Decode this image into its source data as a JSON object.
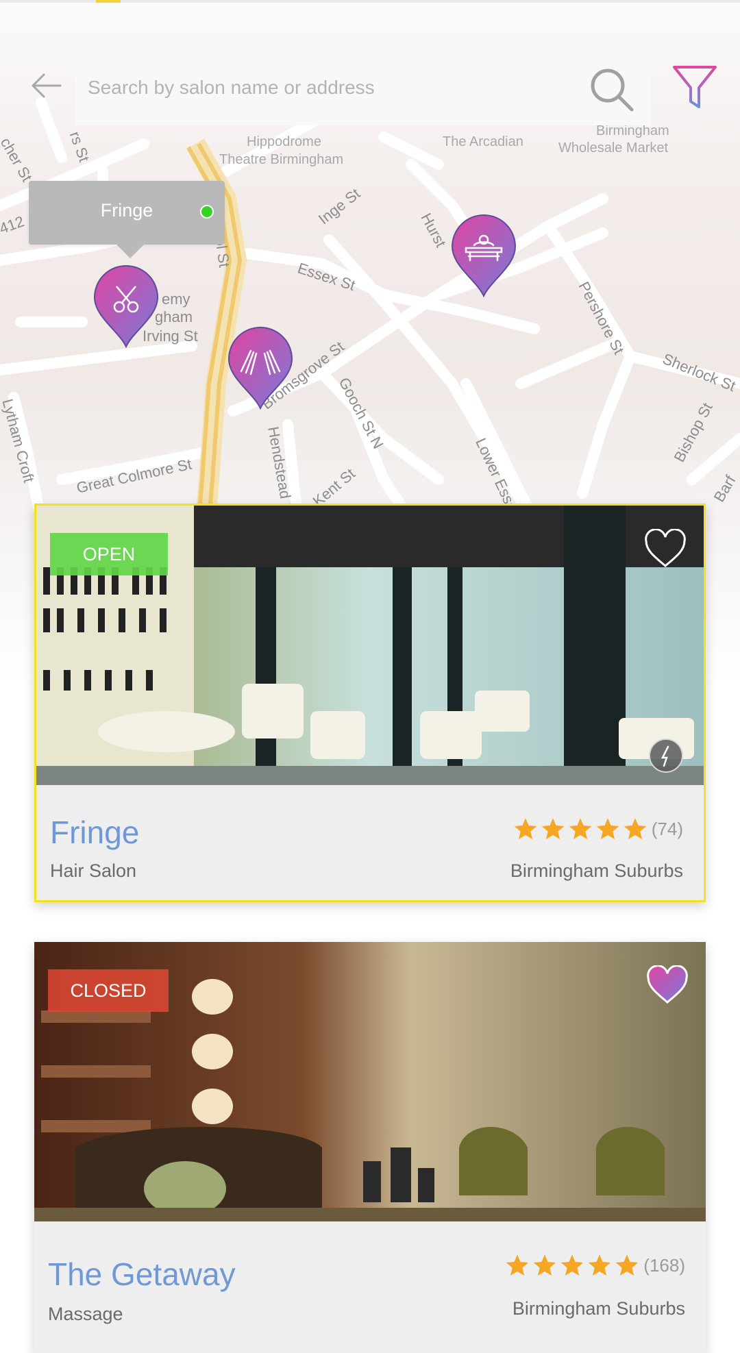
{
  "search": {
    "placeholder": "Search by salon name or address"
  },
  "map": {
    "street_labels": [
      "Hippodrome",
      "Theatre Birmingham",
      "The Arcadian",
      "Wholesale Market",
      "Birmingham",
      "Inge St",
      "Hurst",
      "Essex St",
      "Pershore St",
      "Sherlock St",
      "Bishop St",
      "Bristol St",
      "Irving St",
      "emy",
      "gham",
      "Bromsgrove St",
      "Gooch St N",
      "Hendstead St",
      "Lytham Croft",
      "Great Colmore St",
      "Kent St",
      "Lower Essex",
      "Barf",
      "cher St",
      "412",
      "rs St"
    ],
    "tooltip": {
      "name": "Fringe",
      "status_color": "#34d323"
    },
    "pins": [
      {
        "icon": "scissors-icon"
      },
      {
        "icon": "hands-icon"
      },
      {
        "icon": "massage-bed-icon"
      }
    ]
  },
  "colors": {
    "accent_blue": "#6e98d6",
    "pin_gradient_start": "#e045a0",
    "pin_gradient_end": "#7a7ad8",
    "star": "#f5a623",
    "open": "#61d649",
    "closed": "#de4834",
    "selected_border": "#f2e21c"
  },
  "salons": [
    {
      "status": "OPEN",
      "name": "Fringe",
      "type": "Hair Salon",
      "rating": 5,
      "review_count": "(74)",
      "area": "Birmingham Suburbs",
      "favorite": false,
      "selected": true
    },
    {
      "status": "CLOSED",
      "name": "The Getaway",
      "type": "Massage",
      "rating": 5,
      "review_count": "(168)",
      "area": "Birmingham Suburbs",
      "favorite": true,
      "selected": false
    }
  ]
}
